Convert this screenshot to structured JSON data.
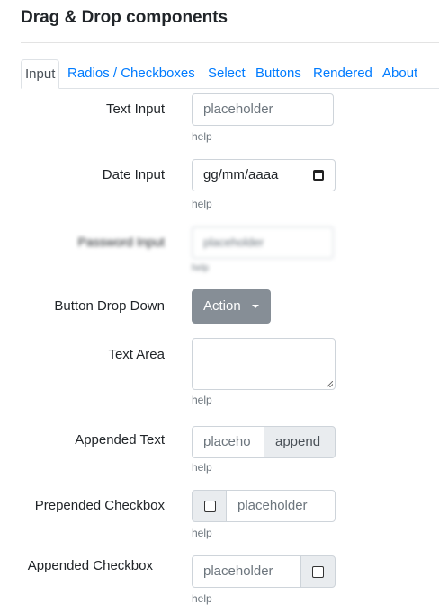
{
  "page": {
    "title": "Drag & Drop components"
  },
  "tabs": [
    "Input",
    "Radios / Checkboxes",
    "Select",
    "Buttons",
    "Rendered",
    "About"
  ],
  "fields": {
    "text_input": {
      "label": "Text Input",
      "placeholder": "placeholder",
      "help": "help"
    },
    "date_input": {
      "label": "Date Input",
      "value": "gg/mm/aaaa",
      "help": "help"
    },
    "password_input": {
      "label": "Password Input",
      "placeholder": "placeholder",
      "help": "help"
    },
    "button_drop_down": {
      "label": "Button Drop Down",
      "button": "Action"
    },
    "text_area": {
      "label": "Text Area",
      "help": "help"
    },
    "appended_text": {
      "label": "Appended Text",
      "placeholder": "placeho",
      "addon": "append",
      "help": "help"
    },
    "prepended_checkbox": {
      "label": "Prepended Checkbox",
      "placeholder": "placeholder",
      "help": "help"
    },
    "appended_checkbox": {
      "label": "Appended Checkbox",
      "placeholder": "placeholder",
      "help": "help"
    }
  },
  "colors": {
    "link": "#007bff",
    "button": "#868e96",
    "addon": "#e9ecef",
    "border": "#ced4da"
  },
  "icons": {
    "date": "calendar-icon",
    "dropdown": "caret-down-icon"
  }
}
